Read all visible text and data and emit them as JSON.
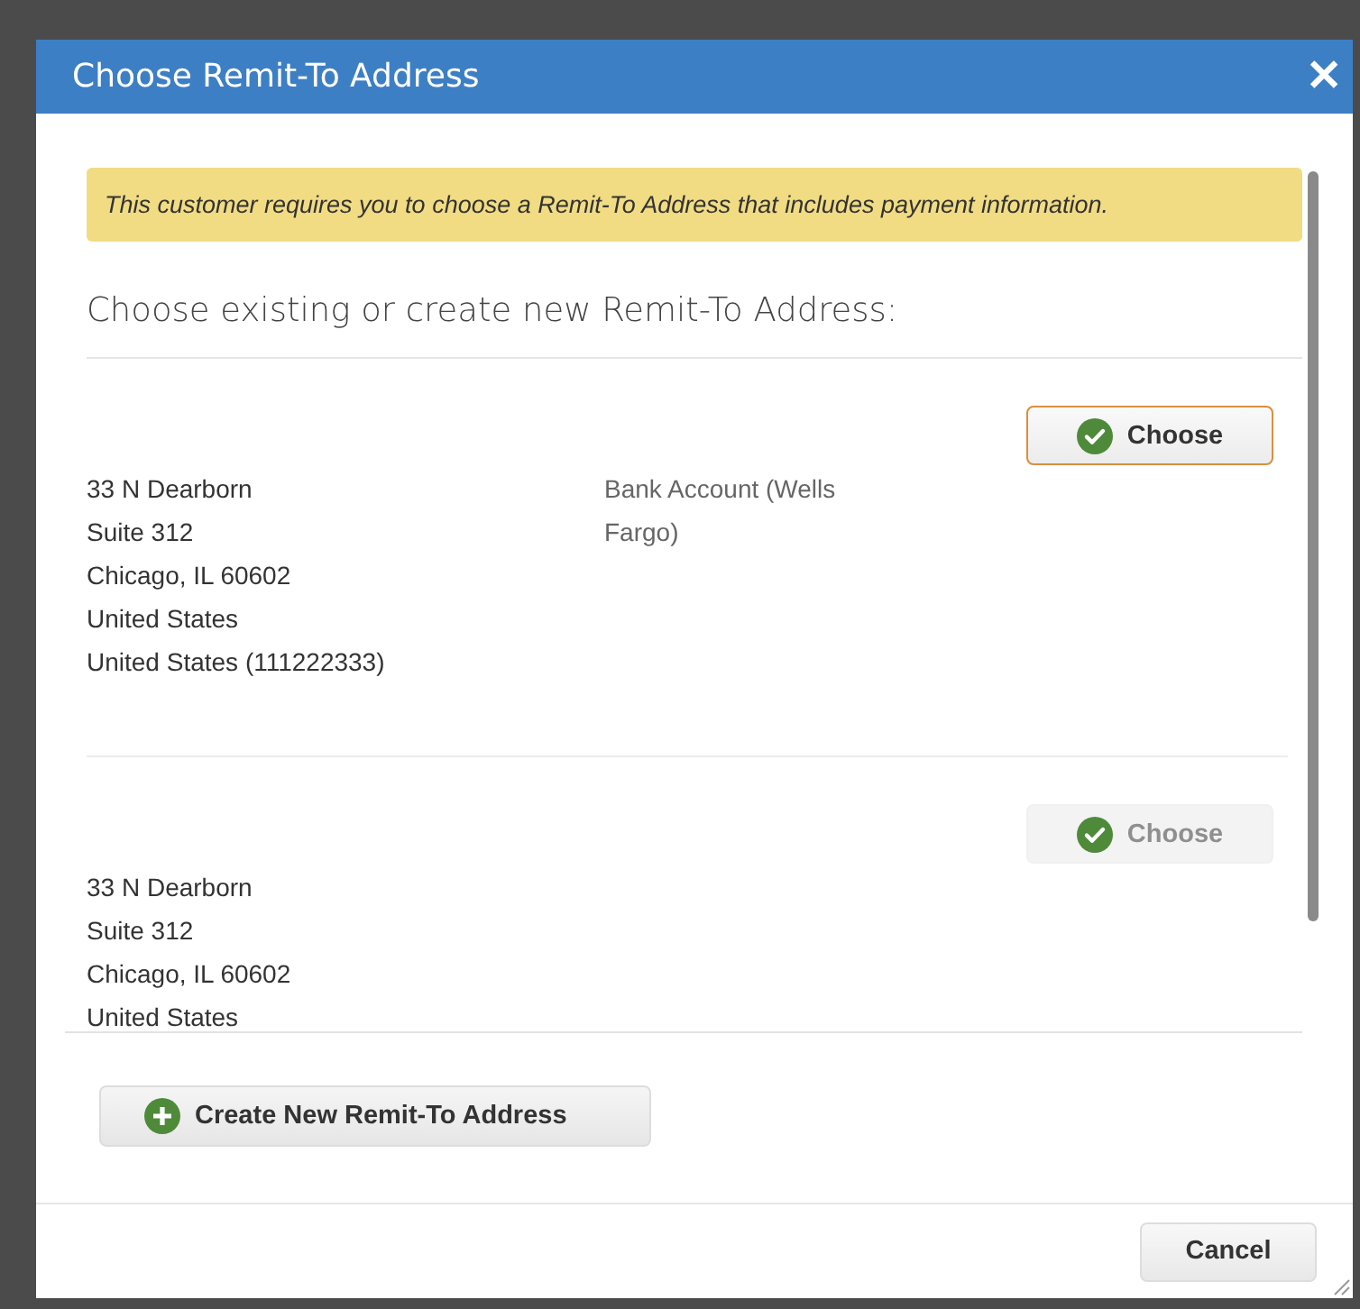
{
  "dialog": {
    "title": "Choose Remit-To Address",
    "close_label": "✕"
  },
  "notice": "This customer requires you to choose a Remit-To Address that includes payment information.",
  "heading": "Choose existing or create new Remit-To Address:",
  "addresses": [
    {
      "lines": [
        "33 N Dearborn",
        "Suite 312",
        "Chicago, IL 60602",
        "United States",
        "United States (111222333)"
      ],
      "payment": "Bank Account (Wells Fargo)",
      "choose": {
        "label": "Choose",
        "selected": true,
        "disabled": false
      }
    },
    {
      "lines": [
        "33 N Dearborn",
        "Suite 312",
        "Chicago, IL 60602",
        "United States"
      ],
      "choose": {
        "label": "Choose",
        "selected": false,
        "disabled": true
      }
    }
  ],
  "create_button": "Create New Remit-To Address",
  "cancel_button": "Cancel"
}
